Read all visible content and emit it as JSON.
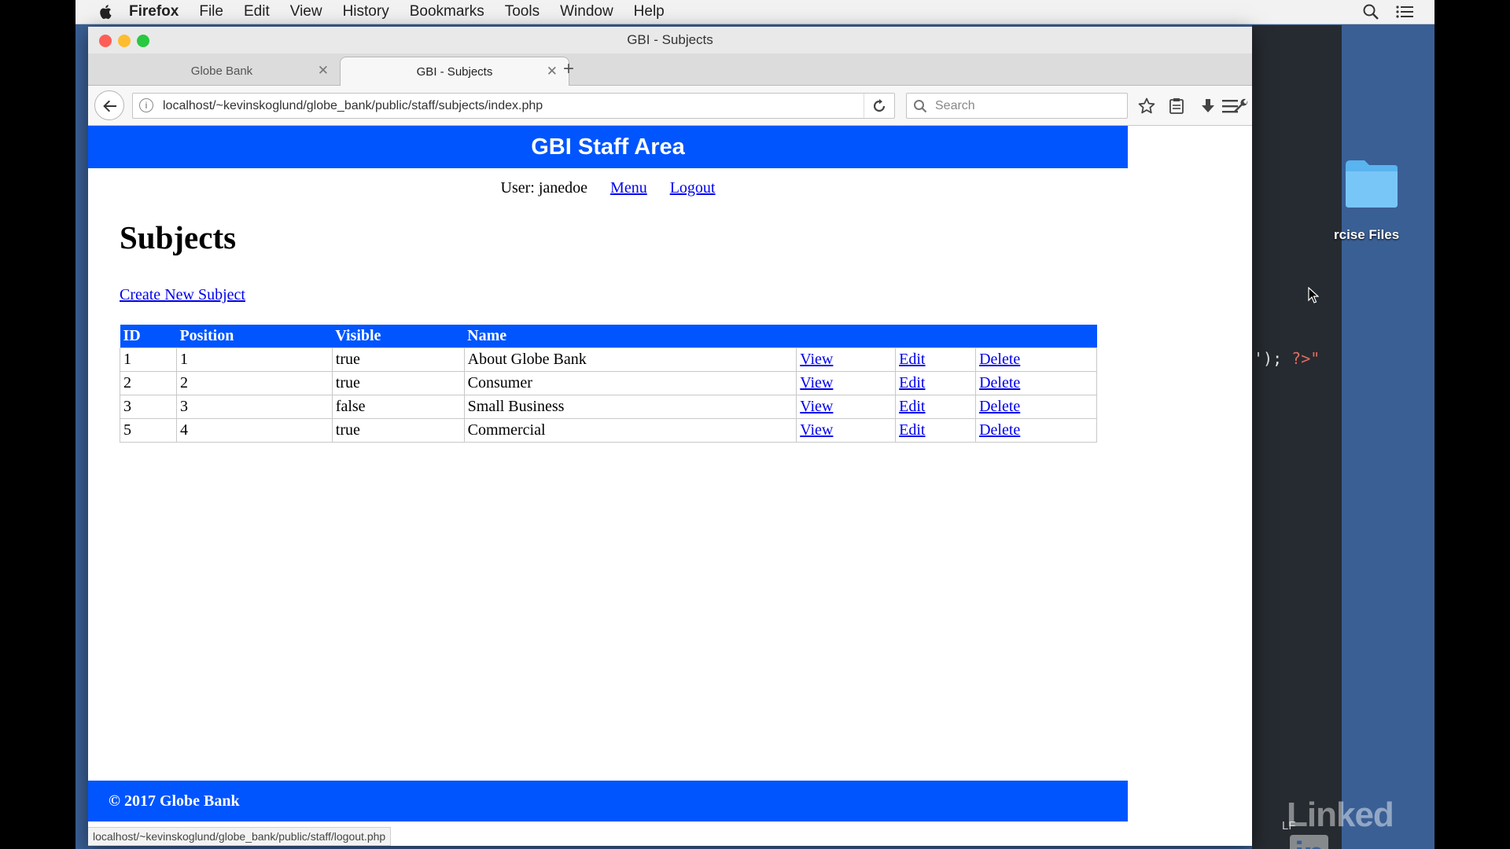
{
  "menubar": {
    "app": "Firefox",
    "items": [
      "File",
      "Edit",
      "View",
      "History",
      "Bookmarks",
      "Tools",
      "Window",
      "Help"
    ]
  },
  "window": {
    "title": "GBI - Subjects"
  },
  "tabs": [
    {
      "label": "Globe Bank",
      "active": false
    },
    {
      "label": "GBI - Subjects",
      "active": true
    }
  ],
  "navbar": {
    "url": "localhost/~kevinskoglund/globe_bank/public/staff/subjects/index.php",
    "search_placeholder": "Search"
  },
  "page": {
    "header": "GBI Staff Area",
    "user_label": "User: janedoe",
    "menu_link": "Menu",
    "logout_link": "Logout",
    "title": "Subjects",
    "create_link": "Create New Subject",
    "table": {
      "headers": [
        "ID",
        "Position",
        "Visible",
        "Name"
      ],
      "rows": [
        {
          "id": "1",
          "position": "1",
          "visible": "true",
          "name": "About Globe Bank",
          "view": "View",
          "edit": "Edit",
          "delete": "Delete"
        },
        {
          "id": "2",
          "position": "2",
          "visible": "true",
          "name": "Consumer",
          "view": "View",
          "edit": "Edit",
          "delete": "Delete"
        },
        {
          "id": "3",
          "position": "3",
          "visible": "false",
          "name": "Small Business",
          "view": "View",
          "edit": "Edit",
          "delete": "Delete"
        },
        {
          "id": "5",
          "position": "4",
          "visible": "true",
          "name": "Commercial",
          "view": "View",
          "edit": "Edit",
          "delete": "Delete"
        }
      ]
    },
    "footer": "© 2017 Globe Bank"
  },
  "statusbar": {
    "text": "localhost/~kevinskoglund/globe_bank/public/staff/logout.php"
  },
  "desktop": {
    "folder_label": "rcise Files",
    "editor_code_plain": "');",
    "editor_code_string": "?>\"",
    "editor_line_ending": "LF",
    "watermark": "Linked",
    "watermark_box": "in"
  },
  "colors": {
    "site_blue": "#0055ff",
    "link_blue": "#0000ee",
    "desktop": "#3a5f95"
  },
  "icons": [
    "apple-icon",
    "spotlight-icon",
    "notification-list-icon",
    "back-arrow-icon",
    "info-icon",
    "reload-icon",
    "search-icon",
    "bookmark-star-icon",
    "reading-list-icon",
    "download-icon",
    "wrench-icon",
    "hamburger-menu-icon",
    "folder-icon",
    "mouse-cursor-icon"
  ]
}
